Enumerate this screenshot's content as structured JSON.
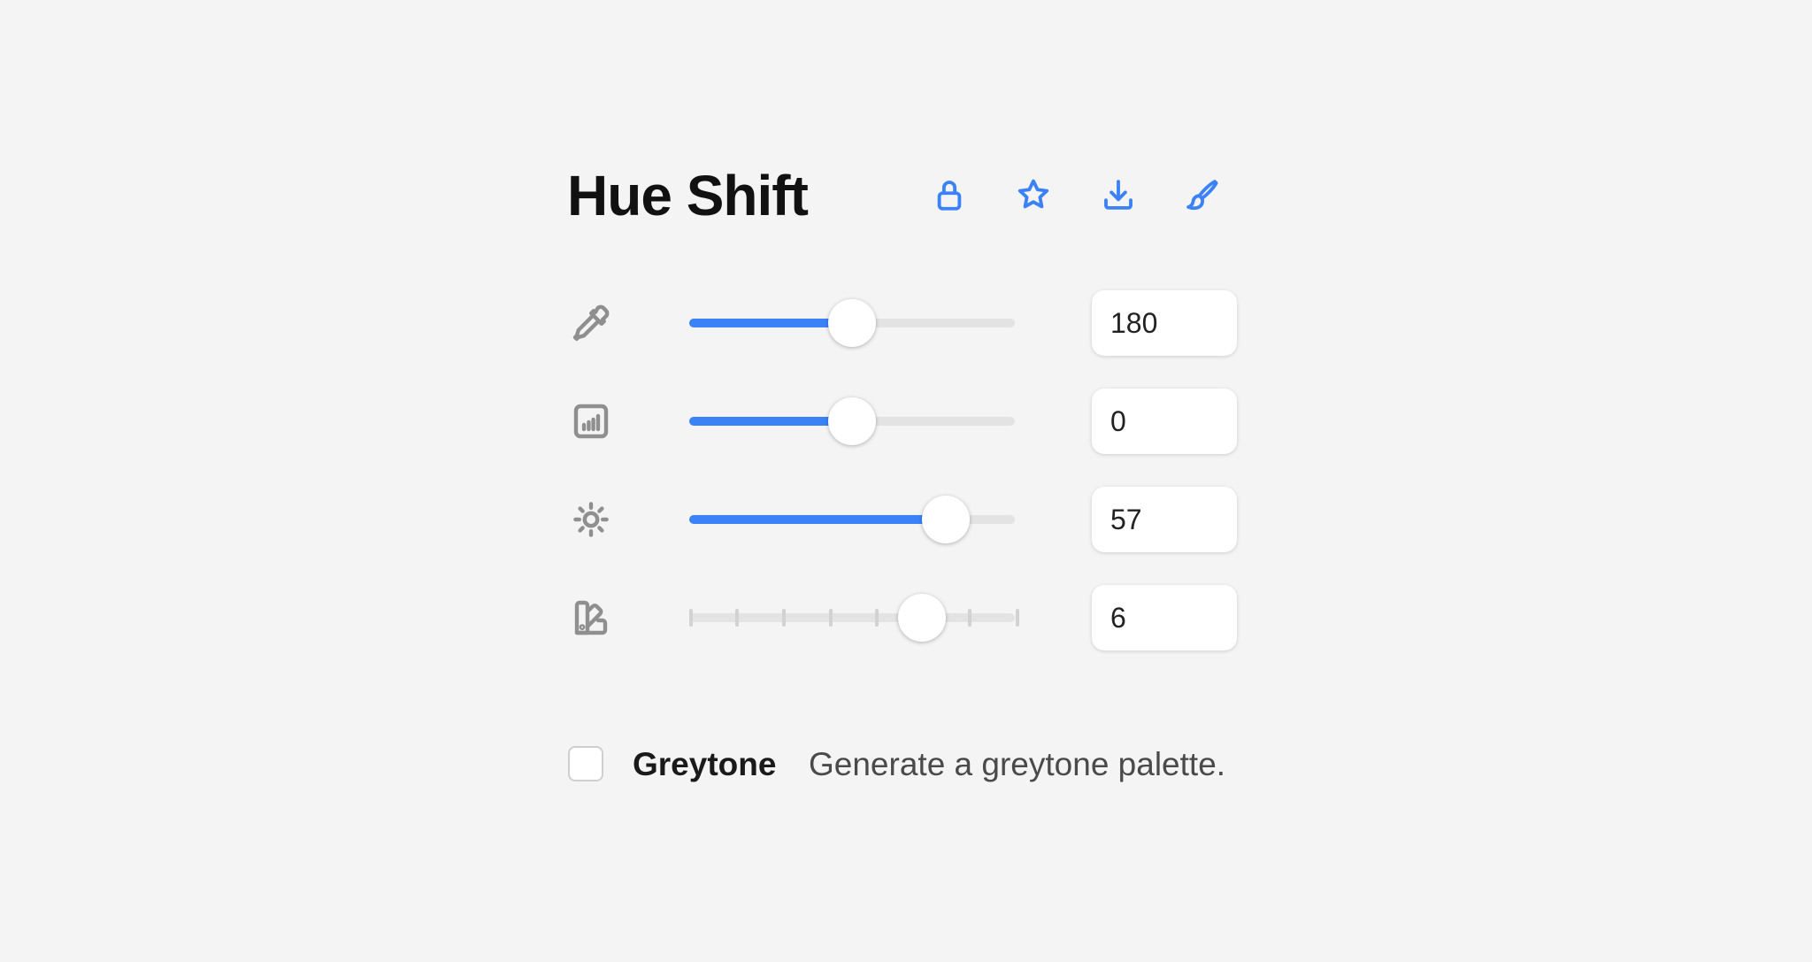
{
  "panel": {
    "title": "Hue Shift"
  },
  "toolbar": {
    "accent_color": "#3b82f6",
    "icons": [
      "lock-icon",
      "star-icon",
      "download-icon",
      "brush-icon"
    ]
  },
  "sliders": [
    {
      "icon": "eyedropper-icon",
      "value": "180",
      "fill_percent": 50,
      "ticks": false
    },
    {
      "icon": "bar-chart-icon",
      "value": "0",
      "fill_percent": 50,
      "ticks": false
    },
    {
      "icon": "sun-icon",
      "value": "57",
      "fill_percent": 79,
      "ticks": false
    },
    {
      "icon": "swatches-icon",
      "value": "6",
      "fill_percent": 71.4,
      "ticks": true,
      "tick_count": 8
    }
  ],
  "greytone": {
    "label": "Greytone",
    "description": "Generate a greytone palette.",
    "checked": false
  }
}
